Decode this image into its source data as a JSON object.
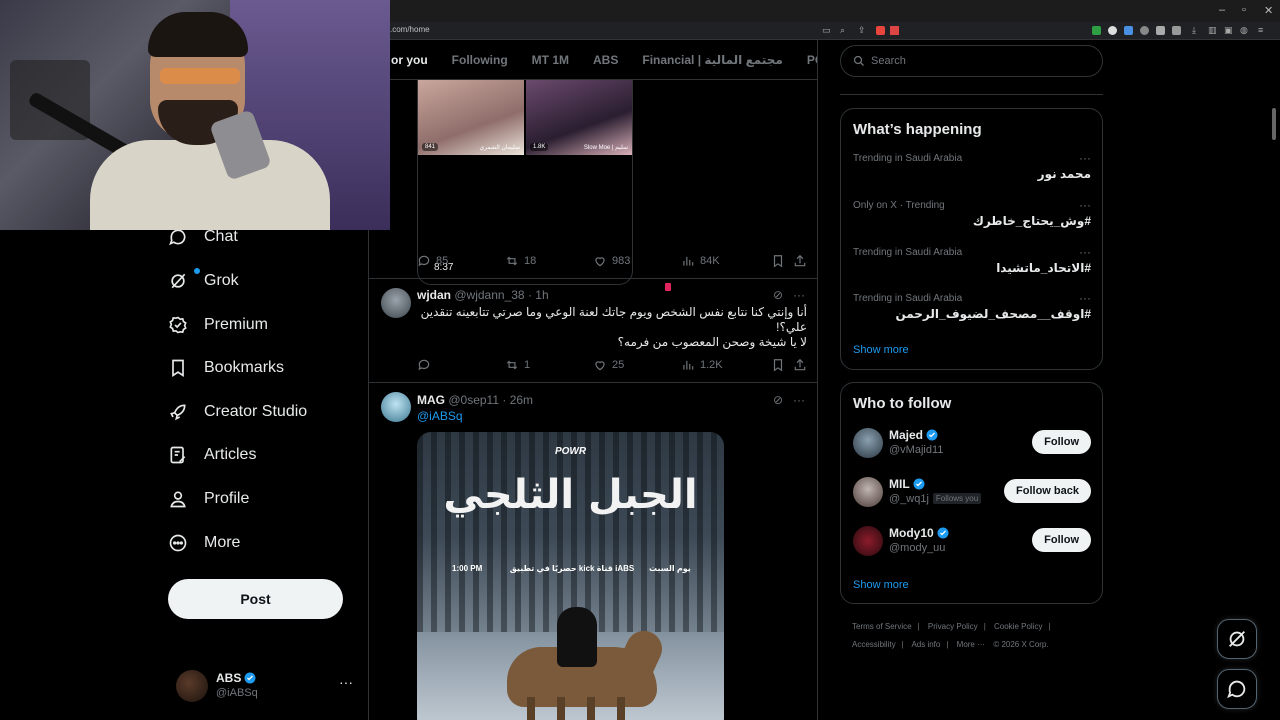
{
  "browser": {
    "url": ".com/home",
    "window_controls": [
      "–",
      "▫",
      "✕"
    ]
  },
  "tabs": [
    {
      "label": "or you",
      "active": true
    },
    {
      "label": "Following"
    },
    {
      "label": "MT 1M"
    },
    {
      "label": "ABS"
    },
    {
      "label": "Financial | مجتمع المالية"
    },
    {
      "label": "POWR | ور"
    }
  ],
  "nav": [
    {
      "label": "Chat",
      "icon": "chat-icon"
    },
    {
      "label": "Grok",
      "icon": "grok-icon"
    },
    {
      "label": "Premium",
      "icon": "premium-icon"
    },
    {
      "label": "Bookmarks",
      "icon": "bookmark-icon"
    },
    {
      "label": "Creator Studio",
      "icon": "rocket-icon"
    },
    {
      "label": "Articles",
      "icon": "articles-icon"
    },
    {
      "label": "Profile",
      "icon": "profile-icon"
    },
    {
      "label": "More",
      "icon": "more-icon"
    }
  ],
  "post_label": "Post",
  "account": {
    "name": "ABS",
    "handle": "@iABSq",
    "more": "···"
  },
  "video_tweet": {
    "thumb_a_tag": "841",
    "thumb_a_name": "سليمان الشمري",
    "thumb_b_tag": "1.8K",
    "thumb_b_name": "Slow Moe | سليم",
    "duration": "8:37",
    "replies": "85",
    "reposts": "18",
    "likes": "983",
    "views": "84K"
  },
  "tweet_wjdan": {
    "name": "wjdan",
    "handle": "@wjdann_38",
    "time": "· 1h",
    "line1": "أنا وإنتي كنا نتابع نفس الشخص ويوم جاتك لعنة الوعي وما صرتي تتابعينه تنقدين",
    "line2": "علي؟!",
    "line3": "لا يا شيخة وصحن المعصوب من فرمه؟",
    "replies": "",
    "reposts": "1",
    "likes": "25",
    "views": "1.2K"
  },
  "tweet_mag": {
    "name": "MAG",
    "handle": "@0sep11",
    "time": "· 26m",
    "mention": "@iABSq",
    "poster_brand": "POWR",
    "poster_title": "الجبل الثلجي",
    "poster_time": "1:00 PM",
    "poster_channel": "iABS قناة kick حصريًا في تطبيق",
    "poster_day": "يوم السبت"
  },
  "search": {
    "placeholder": "Search"
  },
  "happening": {
    "title": "What’s happening",
    "trends": [
      {
        "context": "Trending in Saudi Arabia",
        "name": "محمد نور"
      },
      {
        "context": "Only on X · Trending",
        "name": "#وش_يحتاج_خاطرك"
      },
      {
        "context": "Trending in Saudi Arabia",
        "name": "#الاتحاد_ماتشيدا"
      },
      {
        "context": "Trending in Saudi Arabia",
        "name": "#اوقف__مصحف_لضيوف_الرحمن"
      }
    ],
    "show_more": "Show more"
  },
  "who_to_follow": {
    "title": "Who to follow",
    "accounts": [
      {
        "name": "Majed",
        "handle": "@vMajid11",
        "follows_you": "",
        "button": "Follow"
      },
      {
        "name": "MIL",
        "handle": "@_wq1j",
        "follows_you": "Follows you",
        "button": "Follow back"
      },
      {
        "name": "Mody10",
        "handle": "@mody_uu",
        "follows_you": "",
        "button": "Follow"
      }
    ],
    "show_more": "Show more"
  },
  "footer": {
    "links": [
      "Terms of Service",
      "|",
      "Privacy Policy",
      "|",
      "Cookie Policy",
      "|"
    ],
    "links2": [
      "Accessibility",
      "|",
      "Ads info",
      "|",
      "More ···",
      "© 2026 X Corp."
    ]
  },
  "colors": {
    "accent": "#1d9bf0",
    "background": "#000000",
    "border": "#2f3336",
    "muted": "#71767b"
  }
}
